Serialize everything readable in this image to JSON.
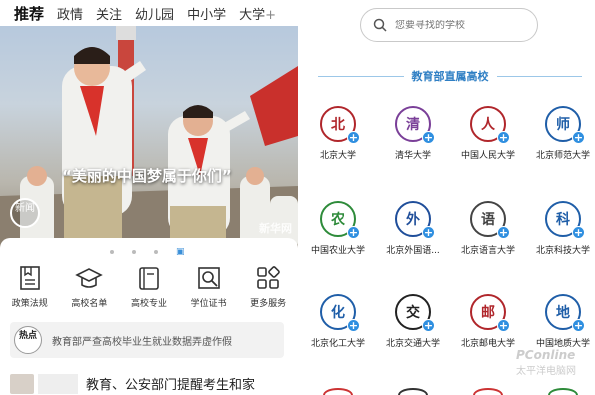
{
  "left": {
    "tabs": [
      "推荐",
      "政情",
      "关注",
      "幼儿园",
      "中小学",
      "大学"
    ],
    "tabs_plus": "+",
    "hero": {
      "caption": "“美丽的中国梦属于你们”",
      "badge": "新闻",
      "watermark": "新华网"
    },
    "services": [
      {
        "label": "政策法规",
        "icon": "policy-icon"
      },
      {
        "label": "高校名单",
        "icon": "graduation-cap-icon"
      },
      {
        "label": "高校专业",
        "icon": "book-icon"
      },
      {
        "label": "学位证书",
        "icon": "certificate-search-icon"
      },
      {
        "label": "更多服务",
        "icon": "grid-more-icon"
      }
    ],
    "hot": {
      "badge": "热点",
      "text": "教育部严查高校毕业生就业数据弄虚作假"
    },
    "news_title": "教育、公安部门提醒考生和家"
  },
  "right": {
    "search_placeholder": "您要寻找的学校",
    "section_title": "教育部直属高校",
    "universities": [
      {
        "name": "北京大学",
        "color": "#b0262b",
        "glyph": "北"
      },
      {
        "name": "清华大学",
        "color": "#7a3f98",
        "glyph": "清"
      },
      {
        "name": "中国人民大学",
        "color": "#b0262b",
        "glyph": "人"
      },
      {
        "name": "北京师范大学",
        "color": "#1f5ea8",
        "glyph": "师"
      },
      {
        "name": "中国农业大学",
        "color": "#2e8b3a",
        "glyph": "农"
      },
      {
        "name": "北京外国语...",
        "color": "#1f4e9a",
        "glyph": "外"
      },
      {
        "name": "北京语言大学",
        "color": "#444444",
        "glyph": "语"
      },
      {
        "name": "北京科技大学",
        "color": "#1f5ea8",
        "glyph": "科"
      },
      {
        "name": "北京化工大学",
        "color": "#1f5ea8",
        "glyph": "化"
      },
      {
        "name": "北京交通大学",
        "color": "#222222",
        "glyph": "交"
      },
      {
        "name": "北京邮电大学",
        "color": "#b0262b",
        "glyph": "邮"
      },
      {
        "name": "中国地质大学",
        "color": "#1f5ea8",
        "glyph": "地"
      }
    ],
    "watermark": "PConline",
    "watermark_sub": "太平洋电脑网"
  }
}
